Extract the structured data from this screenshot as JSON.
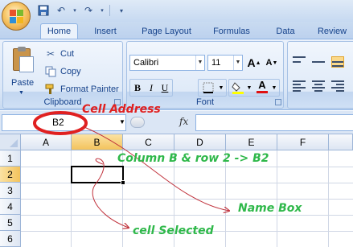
{
  "quick_access": {
    "icons": [
      "save-icon",
      "undo-icon",
      "redo-icon",
      "customize-icon"
    ]
  },
  "tabs": [
    {
      "label": "Home",
      "active": true
    },
    {
      "label": "Insert"
    },
    {
      "label": "Page Layout"
    },
    {
      "label": "Formulas"
    },
    {
      "label": "Data"
    },
    {
      "label": "Review"
    }
  ],
  "clipboard": {
    "group_label": "Clipboard",
    "paste": "Paste",
    "cut": "Cut",
    "copy": "Copy",
    "format_painter": "Format Painter"
  },
  "font": {
    "group_label": "Font",
    "name": "Calibri",
    "size": "11",
    "bold": "B",
    "italic": "I",
    "underline": "U",
    "grow": "A",
    "shrink": "A",
    "font_color_letter": "A"
  },
  "formula_bar": {
    "name_box": "B2",
    "fx": "fx"
  },
  "grid": {
    "columns": [
      "A",
      "B",
      "C",
      "D",
      "E",
      "F"
    ],
    "rows": [
      "1",
      "2",
      "3",
      "4",
      "5",
      "6"
    ],
    "selected_cell": "B2"
  },
  "annotations": {
    "cell_address": "Cell Address",
    "column_row": "Column B & row 2 -> B2",
    "name_box": "Name Box",
    "cell_selected": "cell Selected"
  },
  "colors": {
    "annotation_red": "#e02020",
    "annotation_green": "#2fb84a",
    "selection_header": "#f3c35c"
  }
}
